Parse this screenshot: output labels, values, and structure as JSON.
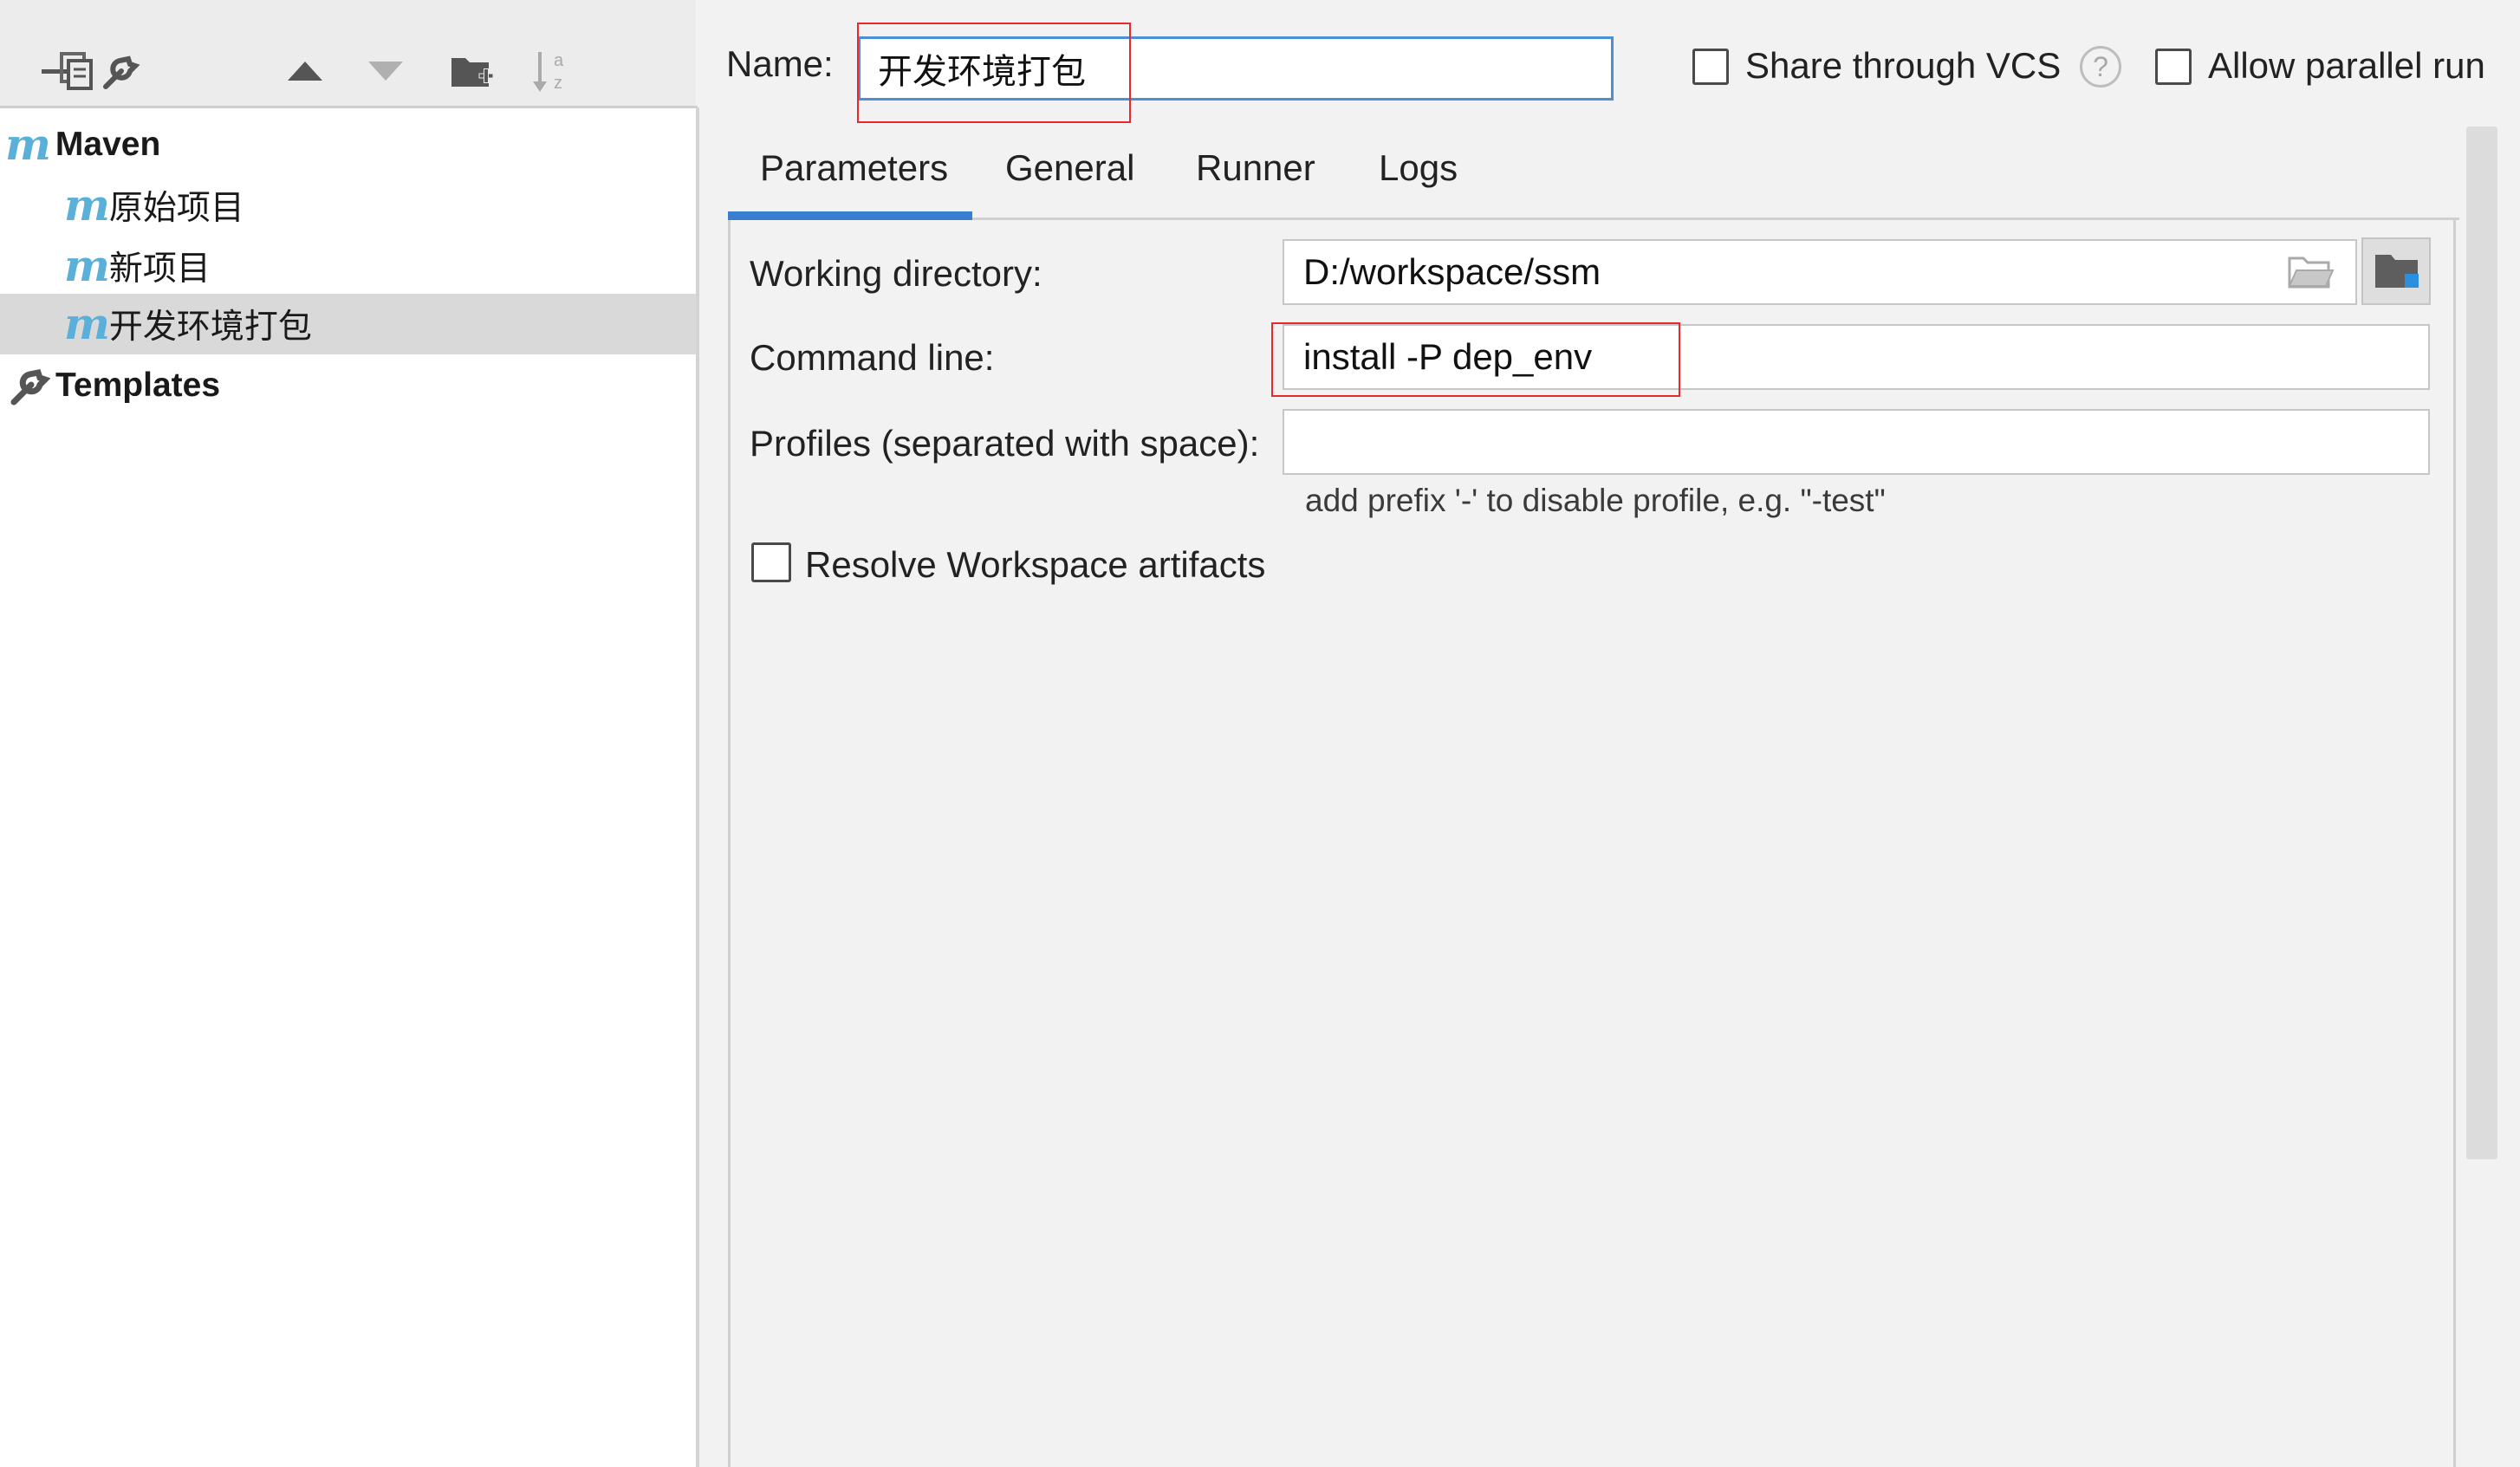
{
  "toolbar": {
    "buttons": [
      {
        "name": "remove",
        "icon": "minus-icon"
      },
      {
        "name": "copy",
        "icon": "copy-icon"
      },
      {
        "name": "edit-defaults",
        "icon": "wrench-icon"
      },
      {
        "name": "move-up",
        "icon": "arrow-up-icon"
      },
      {
        "name": "move-down",
        "icon": "arrow-down-icon"
      },
      {
        "name": "new-folder",
        "icon": "folder-add-icon"
      },
      {
        "name": "sort",
        "icon": "sort-alpha-icon"
      }
    ]
  },
  "tree": {
    "root": {
      "label": "Maven",
      "icon": "maven-icon"
    },
    "children": [
      {
        "label": "原始项目",
        "icon": "maven-icon",
        "selected": false
      },
      {
        "label": "新项目",
        "icon": "maven-icon",
        "selected": false
      },
      {
        "label": "开发环境打包",
        "icon": "maven-icon",
        "selected": true
      }
    ],
    "templates": {
      "label": "Templates",
      "icon": "wrench-icon"
    }
  },
  "config": {
    "name_label": "Name:",
    "name_value": "开发环境打包",
    "share_vcs": {
      "label": "Share through VCS",
      "checked": false
    },
    "help_glyph": "?",
    "allow_parallel": {
      "label": "Allow parallel run",
      "checked": false
    }
  },
  "tabs": [
    {
      "label": "Parameters",
      "active": true
    },
    {
      "label": "General",
      "active": false
    },
    {
      "label": "Runner",
      "active": false
    },
    {
      "label": "Logs",
      "active": false
    }
  ],
  "parameters": {
    "working_directory": {
      "label": "Working directory:",
      "value": "D:/workspace/ssm"
    },
    "command_line": {
      "label": "Command line:",
      "value": "install -P dep_env"
    },
    "profiles": {
      "label": "Profiles (separated with space):",
      "value": "",
      "hint": "add prefix '-' to disable profile, e.g. \"-test\""
    },
    "resolve_workspace": {
      "label": "Resolve Workspace artifacts",
      "checked": false
    }
  },
  "colors": {
    "accent": "#3a7fcf",
    "highlight": "#e8282a",
    "maven_icon": "#5ab0d8",
    "selection": "#d9d9d9"
  }
}
